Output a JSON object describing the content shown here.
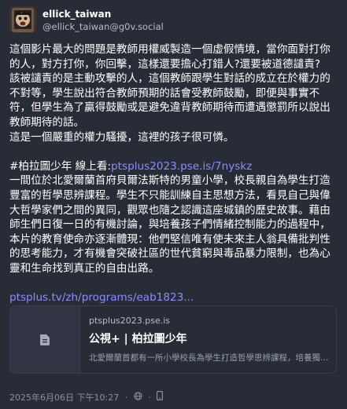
{
  "author": {
    "display_name": "ellick_taiwan",
    "handle": "@ellick_taiwan@g0v.social"
  },
  "content": {
    "para1": "這個影片最大的問題是教師用權威製造一個虛假情境，當你面對打你的人，對方打你，你回擊，這樣還要擔心打錯人?還要被道德譴責?",
    "para2": "該被譴責的是主動攻擊的人，這個教師跟學生對話的成立在於權力的不對等，學生說出符合教師預期的話會受教師鼓勵，即便與事實不符，但學生為了贏得鼓勵或是避免違背教師期待而遭遇懲罰所以說出教師期待的話。",
    "para3": "這是一個嚴重的權力騷擾，這裡的孩子很可憐。",
    "para4_prefix": "#柏拉圖少年 線上看:",
    "para4_link": "ptsplus2023.pse.is/7nyskz",
    "para5": "一間位於北愛爾蘭首府貝爾法斯特的男童小學，校長親自為學生打造豐富的哲學思辨課程。學生不只能訓練自主思想方法，看見自己與偉大哲學家們之間的異同，觀眾也隨之認識這座城鎮的歷史故事。藉由師生們日復一日的有機討論，與培養孩子們情緒控制能力的過程中，本片的教育使命亦逐漸體現：他們堅信唯有使未來主人翁具備批判性的思考能力，才有機會突破社區的世代貧窮與毒品暴力限制，也為心靈和生命找到真正的自由出路。",
    "link2": "ptsplus.tv/zh/programs/eab1823..."
  },
  "card": {
    "host": "ptsplus2023.pse.is",
    "title": "公視+ | 柏拉圖少年",
    "description": "北愛爾蘭首都有一所小學校長為學生打造哲學思辨課程，培養獨立...",
    "thumb_icon": "document-icon"
  },
  "footer": {
    "timestamp": "2025年6月06日 下午10:27",
    "visibility_icon": "globe-icon",
    "app_icon": "device-icon"
  },
  "colors": {
    "background": "#282c37",
    "link": "#8c8dff",
    "muted": "#b8bdcc",
    "border": "#393f4f"
  }
}
